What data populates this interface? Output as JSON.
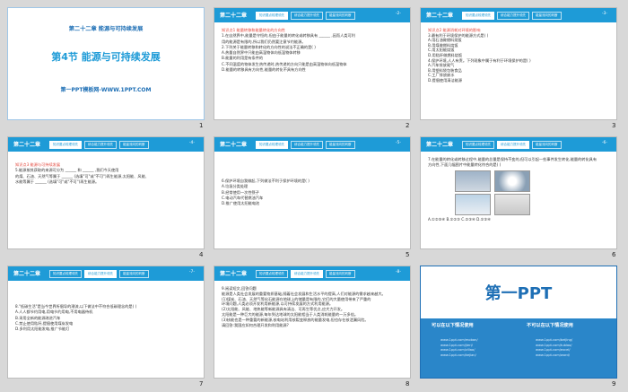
{
  "nav_tabs": [
    "知识要点梳理领先",
    "综合能力提升领先",
    "能量流向的判断"
  ],
  "slides": [
    {
      "num": "1",
      "chapter": "第二十二章  能源与可持续发展",
      "title": "第4节  能源与可持续发展",
      "website": "第一PPT模板网-WWW.1PPT.COM"
    },
    {
      "num": "2",
      "chapter": "第二十二章",
      "page": "-2-",
      "lines": [
        "知识点1  能量转移和能量转化的方向性",
        "1.在自然界中,能量是守恒的,但由于能量的转化或转移具有 ______ ,因而人类可利",
        "用的能源是有限的,所以我们仍然要注意节约能源。",
        "2.下列关于能量转移和转化的方向性的说法不正确的是(     )",
        "A.热量自然界中只能由高温物体向低温物体转移",
        "B.能量的利用是有条件的",
        "C.不同温度的物体发生热传递时,热传递的方向只能是由高温物体向低温物体",
        "D.能量的转移具有方向性,能量的转化不具有方向性"
      ]
    },
    {
      "num": "3",
      "chapter": "第二十二章",
      "page": "-3-",
      "lines": [
        "知识点2  能源消耗对环境的影响",
        "3.最有利于环境保护的能源方式是(     )",
        "A.用石油做燃料烧饭",
        "B.用煤做燃料烧饭",
        "C.用太阳能烧饭",
        "D.用秸秆做燃料烧饭",
        "4.保护环境,人人有责。下列现象中属于有利于环境保护的是(     )",
        "A.汽车排放尾气",
        "B.用塑料袋包装食品",
        "C.工厂排放废水",
        "D.提倡使用清洁能源"
      ]
    },
    {
      "num": "4",
      "chapter": "第二十二章",
      "page": "-4-",
      "lines": [
        "知识点3  能源与可持续发展",
        "5.能源按其获取的来源可分为 ______ 和 ______ ,我们今天使用",
        "的煤、石油、天然气等属于 ______ (选填\"可\"或\"不可\")再生能源,太阳能、风能、",
        "水能等属于 ______ (选填\"可\"或\"不可\")再生能源。"
      ]
    },
    {
      "num": "5",
      "chapter": "第二十二章",
      "page": "-5-",
      "lines": [
        "6.保护环境自我做起,下列做法不利于保护环境的是(     )",
        "A.垃圾分类处理",
        "B.经常使用一次性筷子",
        "C.电动汽车代替燃油汽车",
        "D.推广使用太阳能电池"
      ]
    },
    {
      "num": "6",
      "chapter": "第二十二章",
      "page": "-6-",
      "lines": [
        "7.在能量的转化或转移过程中,能量的总量是保持不变的,但可以引起一些事件发生转化,能量的转化具有",
        "方向性,下面几幅图片中能量转化符合的是(     )"
      ],
      "options": "A.①②③④     B.①②③     C.②③④     D.①③④"
    },
    {
      "num": "7",
      "chapter": "第二十二章",
      "page": "-7-",
      "lines": [
        "8.\"低碳生活\"是当今世界所倡导的潮流,以下做法中不符合低碳理念的是(     )",
        "A.人人都节约用电,用电节约用电,不用电器待机",
        "B.采用全新的能源改进汽车",
        "C.禁止使用秸秆,提倡使用煤炭发电",
        "D.多利用太阳能发电,推广节能灯"
      ]
    },
    {
      "num": "8",
      "chapter": "第二十二章",
      "page": "-8-",
      "lines": [
        "9.阅读短文,回答问题",
        "能源是人类社会发展的重要物质基础,随着社会发展和生活水平的提高,人们对能源的需求越来越大。",
        "(1)煤炭、石油、天然气等化石能源在地球上的储量是有限的,它们的大量使用带来了严重的",
        "环境问题,人类必须开发利用新能源,以可持续发展的方式利用能源。",
        "(2)太阳能、风能、地热能等新能源具有清洁、可再生等优点,应大力开发。",
        "太阳能是一种巨大的能源,每年到达地球的太阳能相当于人类消耗能量的一万多倍。",
        "(3)核能也是一种重要的新能源,核电站利用核裂变释放的能量发电,但也存在核泄漏风险。",
        "请回答:我国应如何合理开发和利用能源?"
      ]
    },
    {
      "num": "9",
      "logo": "第一PPT",
      "left_heading": "可以在以下情况使用",
      "right_heading": "不可以在以下情况使用",
      "links_left": [
        "www.1ppt.com/moban/",
        "www.1ppt.com/jieri/",
        "www.1ppt.com/ziliao/",
        "www.1ppt.com/kejian/"
      ],
      "links_right": [
        "www.1ppt.com/beijing/",
        "www.1ppt.com/tubiao/",
        "www.1ppt.com/excel/",
        "www.1ppt.com/word/"
      ]
    }
  ]
}
